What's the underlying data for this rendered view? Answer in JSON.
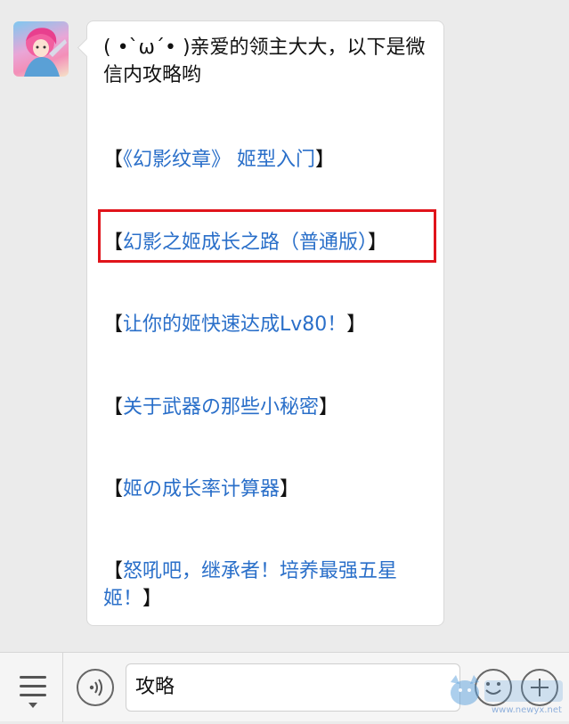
{
  "chat": {
    "intro_text": "( •`ω´• )亲爱的领主大大，以下是微信内攻略哟",
    "links": [
      {
        "open": "【",
        "text": "《幻影纹章》 姬型入门",
        "close": "】"
      },
      {
        "open": "【",
        "text": "幻影之姬成长之路（普通版）",
        "close": "】"
      },
      {
        "open": "【",
        "text": "让你的姬快速达成Lv80！",
        "close": "】"
      },
      {
        "open": "【",
        "text": "关于武器の那些小秘密",
        "close": "】"
      },
      {
        "open": "【",
        "text": "姬の成长率计算器",
        "close": "】"
      },
      {
        "open": "【",
        "text": "怒吼吧，继承者！培养最强五星姬！",
        "close": "】"
      }
    ]
  },
  "input": {
    "value": "攻略"
  },
  "watermark": {
    "text": "www.newyx.net"
  },
  "colors": {
    "link": "#2a6fc9",
    "highlight": "#e0141b",
    "background": "#ebebeb"
  },
  "icons": {
    "menu": "menu-lines-icon",
    "voice": "voice-icon",
    "emoji": "emoji-icon",
    "plus": "plus-icon"
  }
}
